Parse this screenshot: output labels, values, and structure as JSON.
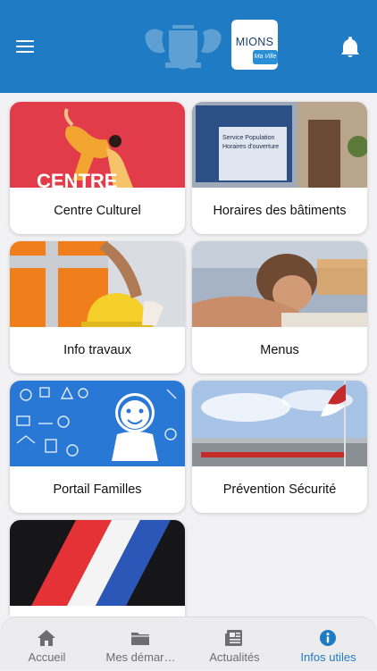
{
  "header": {
    "logo_text": "MIONS",
    "logo_sub": "Ma Ville",
    "brand_color": "#1f7cc4"
  },
  "cards": [
    {
      "label": "Centre Culturel",
      "image_text": "CENTRE"
    },
    {
      "label": "Horaires des bâtiments",
      "image_text_1": "Service Population",
      "image_text_2": "Horaires d'ouverture"
    },
    {
      "label": "Info travaux"
    },
    {
      "label": "Menus"
    },
    {
      "label": "Portail Familles"
    },
    {
      "label": "Prévention Sécurité"
    },
    {
      "label": ""
    }
  ],
  "tabbar": {
    "tabs": [
      {
        "label": "Accueil",
        "icon": "home-icon"
      },
      {
        "label": "Mes démar…",
        "icon": "folder-icon"
      },
      {
        "label": "Actualités",
        "icon": "news-icon"
      },
      {
        "label": "Infos utiles",
        "icon": "info-icon",
        "active": true
      }
    ],
    "active_color": "#1f7cc4"
  }
}
